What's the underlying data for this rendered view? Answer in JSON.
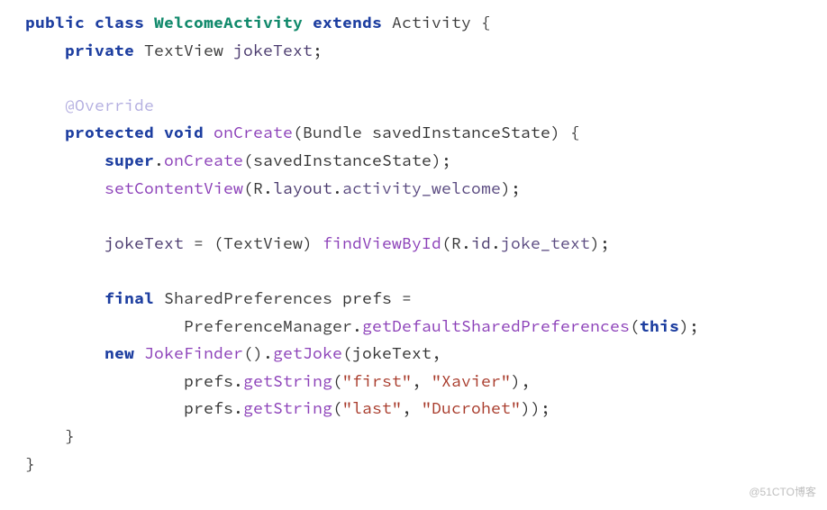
{
  "code": {
    "l1": {
      "kw_public": "public",
      "kw_class": "class",
      "name": "WelcomeActivity",
      "kw_extends": "extends",
      "supertype": "Activity",
      "brace": " {"
    },
    "l2": {
      "kw_private": "private",
      "type": "TextView",
      "field": "jokeText",
      "semi": ";"
    },
    "l3": "",
    "l4": {
      "anno": "@Override"
    },
    "l5": {
      "kw_protected": "protected",
      "kw_void": "void",
      "method": "onCreate",
      "paren_open": "(",
      "param_type": "Bundle",
      "param_name": "savedInstanceState",
      "paren_close": ")",
      "brace": " {"
    },
    "l6": {
      "kw_super": "super",
      "dot": ".",
      "method": "onCreate",
      "paren_open": "(",
      "arg": "savedInstanceState",
      "paren_close": ")",
      "semi": ";"
    },
    "l7": {
      "method": "setContentView",
      "paren_open": "(",
      "R": "R",
      "dot1": ".",
      "layout": "layout",
      "dot2": ".",
      "id": "activity_welcome",
      "paren_close": ")",
      "semi": ";"
    },
    "l8": "",
    "l9": {
      "field": "jokeText",
      "eq": " = ",
      "paren_cast_open": "(",
      "cast_type": "TextView",
      "paren_cast_close": ") ",
      "method": "findViewById",
      "paren_open": "(",
      "R": "R",
      "dot1": ".",
      "idns": "id",
      "dot2": ".",
      "id": "joke_text",
      "paren_close": ")",
      "semi": ";"
    },
    "l10": "",
    "l11": {
      "kw_final": "final",
      "type": "SharedPreferences",
      "var": "prefs",
      "eq": " ="
    },
    "l12": {
      "type": "PreferenceManager",
      "dot": ".",
      "method": "getDefaultSharedPreferences",
      "paren_open": "(",
      "kw_this": "this",
      "paren_close": ")",
      "semi": ";"
    },
    "l13": {
      "kw_new": "new",
      "ctor": "JokeFinder",
      "paren_ctor": "()",
      "dot": ".",
      "method": "getJoke",
      "paren_open": "(",
      "arg": "jokeText",
      "comma": ","
    },
    "l14": {
      "obj": "prefs",
      "dot": ".",
      "method": "getString",
      "paren_open": "(",
      "str1": "\"first\"",
      "comma": ", ",
      "str2": "\"Xavier\"",
      "paren_close": ")",
      "trail": ","
    },
    "l15": {
      "obj": "prefs",
      "dot": ".",
      "method": "getString",
      "paren_open": "(",
      "str1": "\"last\"",
      "comma": ", ",
      "str2": "\"Ducrohet\"",
      "paren_close": "))",
      "semi": ";"
    },
    "l16": {
      "brace": "}"
    },
    "l17": {
      "brace": "}"
    }
  },
  "watermark": "@51CTO博客"
}
